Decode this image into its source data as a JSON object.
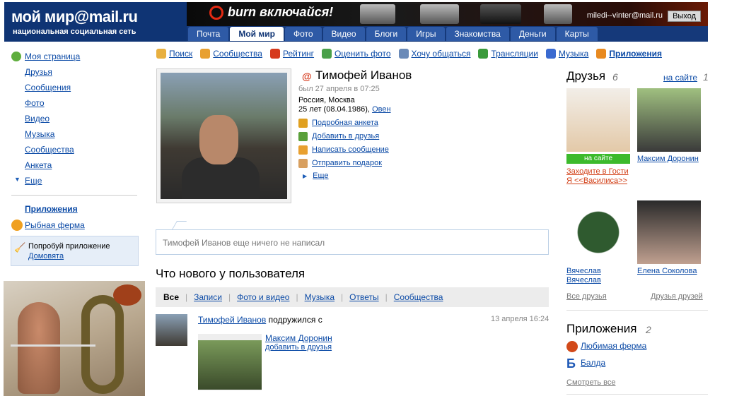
{
  "header": {
    "logo_main": "мой мир@mail.ru",
    "logo_sub": "национальная социальная сеть",
    "ad_text": "burn включайся!",
    "user_email": "miledi--vinter@mail.ru",
    "logout": "Выход",
    "tabs": [
      {
        "label": "Почта"
      },
      {
        "label": "Мой мир"
      },
      {
        "label": "Фото"
      },
      {
        "label": "Видео"
      },
      {
        "label": "Блоги"
      },
      {
        "label": "Игры"
      },
      {
        "label": "Знакомства"
      },
      {
        "label": "Деньги"
      },
      {
        "label": "Карты"
      }
    ]
  },
  "left_menu": {
    "items": [
      {
        "label": "Моя страница"
      },
      {
        "label": "Друзья"
      },
      {
        "label": "Сообщения"
      },
      {
        "label": "Фото"
      },
      {
        "label": "Видео"
      },
      {
        "label": "Музыка"
      },
      {
        "label": "Сообщества"
      },
      {
        "label": "Анкета"
      },
      {
        "label": "Еще"
      }
    ],
    "apps_heading": "Приложения",
    "fish_farm": "Рыбная ферма",
    "try_app_text": "Попробуй приложение",
    "try_app_link": "Домовята"
  },
  "toolbar": {
    "items": [
      {
        "label": "Поиск",
        "icon": "magnifier-icon",
        "color": "#e8b040"
      },
      {
        "label": "Сообщества",
        "icon": "group-icon",
        "color": "#e8a030"
      },
      {
        "label": "Рейтинг",
        "icon": "rating-icon",
        "color": "#d63a1c"
      },
      {
        "label": "Оценить фото",
        "icon": "photo-rate-icon",
        "color": "#4aa04a"
      },
      {
        "label": "Хочу общаться",
        "icon": "chat-icon",
        "color": "#6a8ab8"
      },
      {
        "label": "Трансляции",
        "icon": "broadcast-icon",
        "color": "#3a9a3a"
      },
      {
        "label": "Музыка",
        "icon": "music-icon",
        "color": "#3a6ad0"
      },
      {
        "label": "Приложения",
        "icon": "apps-icon",
        "color": "#e88a20"
      }
    ]
  },
  "profile": {
    "name": "Тимофей Иванов",
    "last_seen": "был 27 апреля в 07:25",
    "location": "Россия, Москва",
    "age": "25 лет (08.04.1986),",
    "zodiac": "Овен",
    "actions": [
      {
        "label": "Подробная анкета",
        "icon": "info-icon",
        "color": "#e0a020"
      },
      {
        "label": "Добавить в друзья",
        "icon": "add-friend-icon",
        "color": "#5aa03a"
      },
      {
        "label": "Написать сообщение",
        "icon": "message-icon",
        "color": "#e8a030"
      },
      {
        "label": "Отправить подарок",
        "icon": "gift-icon",
        "color": "#d8a060"
      }
    ],
    "more": "Еще"
  },
  "status": {
    "text": "Тимофей Иванов еще ничего не написал"
  },
  "feed": {
    "title": "Что нового у пользователя",
    "filters": [
      {
        "label": "Все"
      },
      {
        "label": "Записи"
      },
      {
        "label": "Фото и видео"
      },
      {
        "label": "Музыка"
      },
      {
        "label": "Ответы"
      },
      {
        "label": "Сообщества"
      }
    ],
    "entry": {
      "author": "Тимофей Иванов",
      "action": "подружился с",
      "time": "13 апреля 16:24",
      "friend_name": "Максим Доронин",
      "add_friend": "добавить в друзья"
    }
  },
  "friends": {
    "title": "Друзья",
    "count": "6",
    "online_link": "на сайте",
    "online_count": "1",
    "online_badge": "на сайте",
    "guest_link": "Заходите в Гости Я <<Василиса>>",
    "names": [
      "Максим Доронин",
      "Вячеслав Вячеслав",
      "Елена Соколова"
    ],
    "all_friends": "Все друзья",
    "friends_of_friends": "Друзья друзей"
  },
  "apps": {
    "title": "Приложения",
    "count": "2",
    "items": [
      {
        "label": "Любимая ферма"
      },
      {
        "label": "Балда"
      }
    ],
    "see_all": "Смотреть все"
  }
}
